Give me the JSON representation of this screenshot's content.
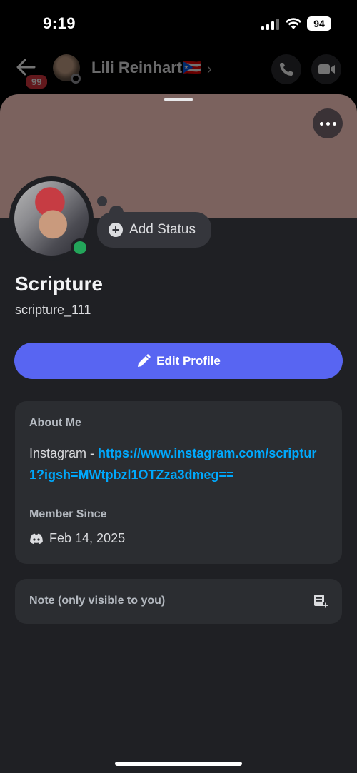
{
  "status_bar": {
    "time": "9:19",
    "battery": "94"
  },
  "chat_header": {
    "unread_count": "99",
    "name": "Lili Reinhart",
    "flag": "🇵🇷",
    "chevron": "›"
  },
  "profile": {
    "display_name": "Scripture",
    "username": "scripture_111",
    "add_status_label": "Add Status",
    "edit_profile_label": "Edit Profile",
    "banner_color": "#7b625e",
    "online_color": "#23a55a",
    "accent_color": "#5865f2"
  },
  "about": {
    "title": "About Me",
    "prefix": "Instagram - ",
    "link": "https://www.instagram.com/scriptur1?igsh=MWtpbzl1OTZza3dmeg==",
    "member_since_title": "Member Since",
    "member_since_date": "Feb 14, 2025"
  },
  "note": {
    "placeholder": "Note (only visible to you)"
  },
  "icons": {
    "back": "arrow-left-icon",
    "call": "phone-icon",
    "video": "video-camera-icon",
    "more": "more-horizontal-icon",
    "edit": "pencil-icon",
    "discord": "discord-logo-icon",
    "note": "note-add-icon"
  }
}
